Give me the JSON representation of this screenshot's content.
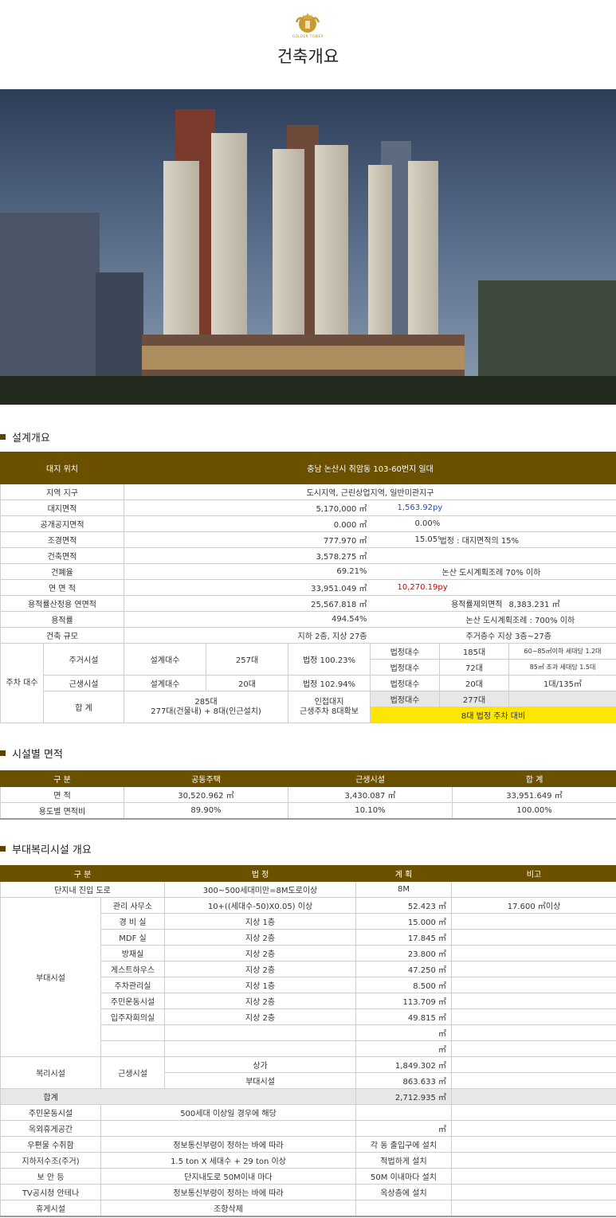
{
  "header": {
    "logo_text": "GOLDEN TOWER",
    "title": "건축개요"
  },
  "colors": {
    "brand_brown": "#6b5000",
    "highlight_yellow": "#ffe600",
    "blue": "#1f4fc4",
    "red": "#d40000"
  },
  "section1": {
    "title": "설계개요",
    "header_label": "대지 위치",
    "header_value": "충남 논산시 취암동 103-60번지 일대",
    "rows": {
      "zone": {
        "label": "지역 지구",
        "value": "도시지역, 근린상업지역, 일반미관지구"
      },
      "site_area": {
        "label": "대지면적",
        "value": "5,170,000 ㎡",
        "py": "1,563.92py"
      },
      "public_area": {
        "label": "공개공지면적",
        "value": "0.000 ㎡",
        "pct": "0.00%"
      },
      "landscape": {
        "label": "조경면적",
        "value": "777.970 ㎡",
        "pct": "15.05%",
        "note": "법정 : 대지면적의 15%"
      },
      "building_area": {
        "label": "건축면적",
        "value": "3,578.275 ㎡"
      },
      "coverage": {
        "label": "건폐율",
        "value": "69.21%",
        "note": "논산 도시계획조례 70% 이하"
      },
      "total_floor": {
        "label": "연 면 적",
        "value": "33,951.049 ㎡",
        "py": "10,270.19py"
      },
      "far_floor": {
        "label": "용적률산정용 연면적",
        "value": "25,567.818 ㎡",
        "excl_label": "용적률제외면적",
        "excl_value": "8,383.231 ㎡"
      },
      "far": {
        "label": "용적률",
        "value": "494.54%",
        "note": "논산 도시계획조례 : 700% 이하"
      },
      "scale": {
        "label": "건축 규모",
        "value": "지하 2층, 지상 27층",
        "note": "주거층수 지상 3층~27층"
      }
    },
    "parking": {
      "label": "주차 대수",
      "res": {
        "label": "주거시설",
        "design": "설계대수",
        "count": "257대",
        "legal": "법정 100.23%",
        "rows": [
          {
            "label": "법정대수",
            "count": "185대",
            "rule": "60~85㎡이하 세대당 1.2대"
          },
          {
            "label": "법정대수",
            "count": "72대",
            "rule": "85㎡ 초과 세대당 1.5대"
          }
        ]
      },
      "com": {
        "label": "근생시설",
        "design": "설계대수",
        "count": "20대",
        "legal": "법정 102.94%",
        "legal_label": "법정대수",
        "legal_count": "20대",
        "rule": "1대/135㎡"
      },
      "total": {
        "label": "합 계",
        "count": "285대",
        "detail": "277대(건물내) + 8대(인근설치)",
        "note1": "인접대지",
        "note2": "근생주차 8대확보",
        "legal_label": "법정대수",
        "legal_count": "277대",
        "highlight": "8대 법정 주차 대비"
      }
    }
  },
  "section2": {
    "title": "시설별 면적",
    "headers": [
      "구 분",
      "공동주택",
      "근생시설",
      "합 계"
    ],
    "rows": [
      [
        "면 적",
        "30,520.962 ㎡",
        "3,430.087 ㎡",
        "33,951.649 ㎡"
      ],
      [
        "용도별 면적비",
        "89.90%",
        "10.10%",
        "100.00%"
      ]
    ]
  },
  "section3": {
    "title": "부대복리시설 개요",
    "headers": [
      "구 분",
      "법 정",
      "계 획",
      "비고"
    ],
    "road": {
      "label": "단지내 진입 도로",
      "legal": "300~500세대미만=8M도로이상",
      "plan": "8M"
    },
    "aux_label": "부대시설",
    "aux": [
      {
        "name": "관리 사무소",
        "legal": "10+((세대수-50)X0.05) 이상",
        "plan": "52.423 ㎡",
        "note": "17.600 ㎡이상"
      },
      {
        "name": "경 비 실",
        "legal": "지상 1층",
        "plan": "15.000 ㎡",
        "note": ""
      },
      {
        "name": "MDF 실",
        "legal": "지상 2층",
        "plan": "17.845 ㎡",
        "note": ""
      },
      {
        "name": "방재실",
        "legal": "지상 2층",
        "plan": "23.800 ㎡",
        "note": ""
      },
      {
        "name": "게스트하우스",
        "legal": "지상 2층",
        "plan": "47.250 ㎡",
        "note": ""
      },
      {
        "name": "주차관리실",
        "legal": "지상 1층",
        "plan": "8.500 ㎡",
        "note": ""
      },
      {
        "name": "주민운동시설",
        "legal": "지상 2층",
        "plan": "113.709 ㎡",
        "note": ""
      },
      {
        "name": "입주자회의실",
        "legal": "지상 2층",
        "plan": "49.815 ㎡",
        "note": ""
      },
      {
        "name": "",
        "legal": "",
        "plan": "㎡",
        "note": ""
      },
      {
        "name": "",
        "legal": "",
        "plan": "㎡",
        "note": ""
      }
    ],
    "welfare": {
      "label": "복리시설",
      "sub": "근생시설",
      "items": [
        {
          "name": "상가",
          "plan": "1,849.302 ㎡"
        },
        {
          "name": "부대시설",
          "plan": "863.633 ㎡"
        }
      ]
    },
    "total": {
      "label": "합계",
      "plan": "2,712.935 ㎡"
    },
    "misc": [
      {
        "label": "주민운동시설",
        "legal": "500세대 이상일 경우에 해당",
        "plan": ""
      },
      {
        "label": "옥외휴게공간",
        "legal": "",
        "plan": "㎡"
      },
      {
        "label": "우편물 수취함",
        "legal": "정보통신부령이 정하는 바에 따라",
        "plan": "각 동 출입구에 설치"
      },
      {
        "label": "지하저수조(주거)",
        "legal": "1.5 ton X 세대수 + 29 ton 이상",
        "plan": "적법하게 설치"
      },
      {
        "label": "보 안 등",
        "legal": "단지내도로 50M이내 마다",
        "plan": "50M 이내마다 설치"
      },
      {
        "label": "TV공시청 안테나",
        "legal": "정보통신부령이 정하는 바에 따라",
        "plan": "옥상층에 설치"
      },
      {
        "label": "휴게시설",
        "legal": "조항삭제",
        "plan": ""
      }
    ]
  }
}
